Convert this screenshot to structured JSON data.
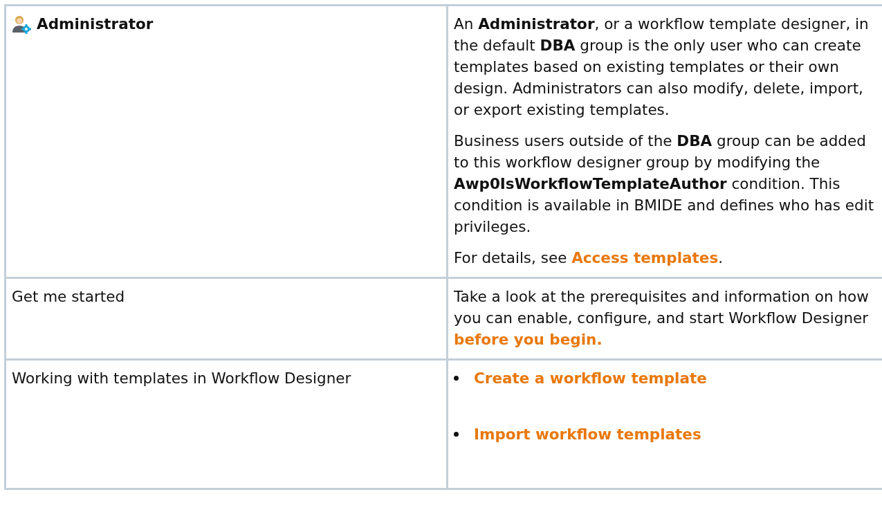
{
  "rows": [
    {
      "label": "Administrator",
      "kind": "role",
      "paragraphs": [
        [
          {
            "kind": "text",
            "text": "An "
          },
          {
            "kind": "bold",
            "text": "Administrator"
          },
          {
            "kind": "text",
            "text": ", or a workflow template designer, in the default "
          },
          {
            "kind": "bold",
            "text": "DBA"
          },
          {
            "kind": "text",
            "text": " group is the only user who can create templates based on existing templates or their own design. Administrators can also modify, delete, import, or export existing templates."
          }
        ],
        [
          {
            "kind": "text",
            "text": "Business users outside of the "
          },
          {
            "kind": "bold",
            "text": "DBA"
          },
          {
            "kind": "text",
            "text": " group can be added to this workflow designer group by modifying the "
          },
          {
            "kind": "bold",
            "text": "Awp0IsWorkflowTemplateAuthor"
          },
          {
            "kind": "text",
            "text": " condition. This condition is available in BMIDE and defines who has edit privileges."
          }
        ],
        [
          {
            "kind": "text",
            "text": "For details, see "
          },
          {
            "kind": "link",
            "text": "Access templates"
          },
          {
            "kind": "text",
            "text": "."
          }
        ]
      ]
    },
    {
      "label": "Get me started",
      "kind": "plain",
      "paragraphs": [
        [
          {
            "kind": "text",
            "text": "Take a look at the prerequisites and information on how you can enable, configure, and start Workflow Designer "
          },
          {
            "kind": "link",
            "text": "before you begin."
          }
        ]
      ]
    },
    {
      "label": "Working with templates in Workflow Designer",
      "kind": "plain",
      "links": [
        "Create a workflow template",
        "Import workflow templates"
      ]
    }
  ]
}
